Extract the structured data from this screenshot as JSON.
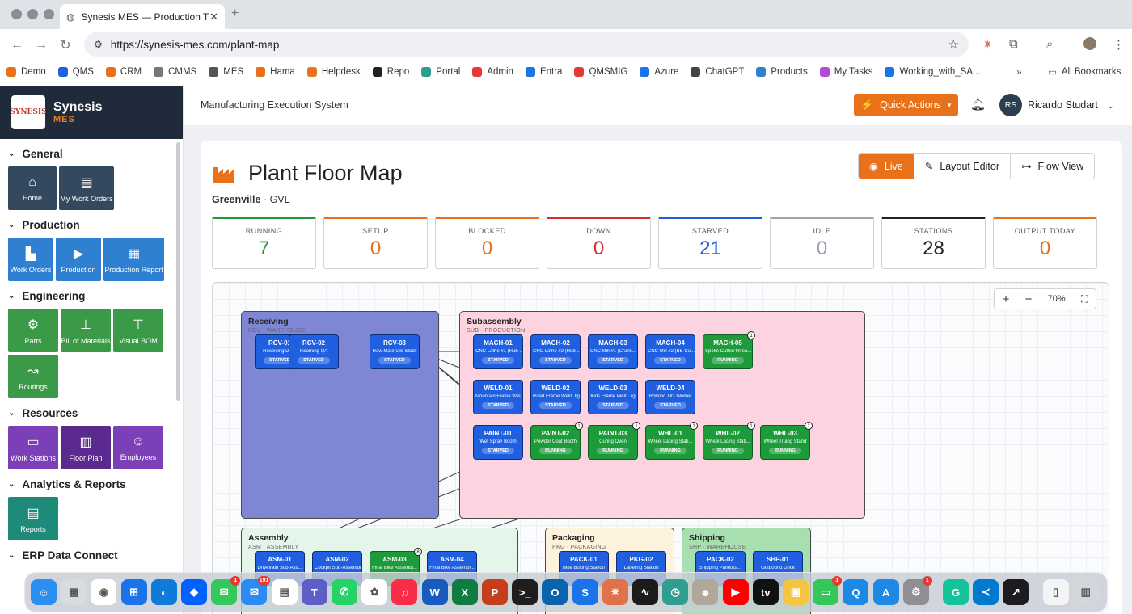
{
  "browser": {
    "tab_title": "Synesis MES — Production Tr",
    "url": "https://synesis-mes.com/plant-map",
    "bookmarks": [
      "Demo",
      "QMS",
      "CRM",
      "CMMS",
      "MES",
      "Hama",
      "Helpdesk",
      "Repo",
      "Portal",
      "Admin",
      "Entra",
      "QMSMIG",
      "Azure",
      "ChatGPT",
      "Products",
      "My Tasks",
      "Working_with_SA..."
    ],
    "all_bookmarks": "All Bookmarks"
  },
  "brand": {
    "name": "Synesis",
    "sub": "MES",
    "logo_text": "SYNESIS"
  },
  "header": {
    "system": "Manufacturing Execution System",
    "quick_actions": "Quick Actions",
    "avatar": "RS",
    "user": "Ricardo Studart"
  },
  "sidebar": {
    "sections": [
      {
        "title": "General",
        "tiles": [
          {
            "label": "Home",
            "icon": "⌂",
            "color": "#34495e"
          },
          {
            "label": "My Work Orders",
            "icon": "▤",
            "color": "#34495e"
          }
        ]
      },
      {
        "title": "Production",
        "tiles": [
          {
            "label": "Work Orders",
            "icon": "▙",
            "color": "#2f80d1"
          },
          {
            "label": "Production",
            "icon": "▶",
            "color": "#2f80d1"
          },
          {
            "label": "Production Report",
            "icon": "▦",
            "color": "#2f80d1"
          }
        ]
      },
      {
        "title": "Engineering",
        "tiles": [
          {
            "label": "Parts",
            "icon": "⚙",
            "color": "#3a9a48"
          },
          {
            "label": "Bill of Materials",
            "icon": "⊥",
            "color": "#3a9a48"
          },
          {
            "label": "Visual BOM",
            "icon": "⊤",
            "color": "#3a9a48"
          },
          {
            "label": "Routings",
            "icon": "↝",
            "color": "#3a9a48"
          }
        ]
      },
      {
        "title": "Resources",
        "tiles": [
          {
            "label": "Work Stations",
            "icon": "▭",
            "color": "#7b3fb8"
          },
          {
            "label": "Floor Plan",
            "icon": "▥",
            "color": "#5b2a8f"
          },
          {
            "label": "Employees",
            "icon": "☺",
            "color": "#7b3fb8"
          }
        ]
      },
      {
        "title": "Analytics & Reports",
        "tiles": [
          {
            "label": "Reports",
            "icon": "▤",
            "color": "#1e8a78"
          }
        ]
      },
      {
        "title": "ERP Data Connect",
        "tiles": []
      }
    ]
  },
  "page": {
    "title": "Plant Floor Map",
    "site": "Greenville",
    "site_code": "GVL",
    "views": [
      "Live",
      "Layout Editor",
      "Flow View"
    ],
    "active_view": "Live",
    "zoom": "70%"
  },
  "stats": [
    {
      "label": "RUNNING",
      "value": "7",
      "color": "#1d9a3a"
    },
    {
      "label": "SETUP",
      "value": "0",
      "color": "#e8711a"
    },
    {
      "label": "BLOCKED",
      "value": "0",
      "color": "#e8711a"
    },
    {
      "label": "DOWN",
      "value": "0",
      "color": "#d32f2f"
    },
    {
      "label": "STARVED",
      "value": "21",
      "color": "#1f5fe0"
    },
    {
      "label": "IDLE",
      "value": "0",
      "color": "#9aa3ad"
    },
    {
      "label": "STATIONS",
      "value": "28",
      "color": "#222222"
    },
    {
      "label": "OUTPUT TODAY",
      "value": "0",
      "color": "#e8711a"
    }
  ],
  "zones": [
    {
      "key": "receiving",
      "title": "Receiving",
      "sub": "RCV · WAREHOUSE",
      "color": "#7f86d6"
    },
    {
      "key": "subassembly",
      "title": "Subassembly",
      "sub": "SUB · PRODUCTION",
      "color": "#fdd3df"
    },
    {
      "key": "assembly",
      "title": "Assembly",
      "sub": "ASM · ASSEMBLY",
      "color": "#e4f5ea"
    },
    {
      "key": "packaging",
      "title": "Packaging",
      "sub": "PKG · PACKAGING",
      "color": "#fdf3dc"
    },
    {
      "key": "shipping",
      "title": "Shipping",
      "sub": "SHP · WAREHOUSE",
      "color": "#a8dfb0"
    }
  ],
  "stations": [
    {
      "id": "RCV-01",
      "name": "Receiving Dock",
      "status": "STARVED",
      "color": "blue",
      "badge": ""
    },
    {
      "id": "RCV-02",
      "name": "Incoming QA",
      "status": "STARVED",
      "color": "blue",
      "badge": ""
    },
    {
      "id": "RCV-03",
      "name": "Raw Materials Stock",
      "status": "STARVED",
      "color": "blue",
      "badge": ""
    },
    {
      "id": "MACH-01",
      "name": "CNC Lathe #1 (Hub ...",
      "status": "STARVED",
      "color": "blue",
      "badge": ""
    },
    {
      "id": "MACH-02",
      "name": "CNC Lathe #2 (Hub ...",
      "status": "STARVED",
      "color": "blue",
      "badge": ""
    },
    {
      "id": "MACH-03",
      "name": "CNC Mill #1 (Crank...",
      "status": "STARVED",
      "color": "blue",
      "badge": ""
    },
    {
      "id": "MACH-04",
      "name": "CNC Mill #2 (BB Cu...",
      "status": "STARVED",
      "color": "blue",
      "badge": ""
    },
    {
      "id": "MACH-05",
      "name": "Spoke Cutter/Threa...",
      "status": "RUNNING",
      "color": "green",
      "badge": "1"
    },
    {
      "id": "WELD-01",
      "name": "Mountain Frame Wel...",
      "status": "STARVED",
      "color": "blue",
      "badge": ""
    },
    {
      "id": "WELD-02",
      "name": "Road Frame Weld Jig",
      "status": "STARVED",
      "color": "blue",
      "badge": ""
    },
    {
      "id": "WELD-03",
      "name": "Kids Frame Weld Jig",
      "status": "STARVED",
      "color": "blue",
      "badge": ""
    },
    {
      "id": "WELD-04",
      "name": "Robotic TIG Welder",
      "status": "STARVED",
      "color": "blue",
      "badge": ""
    },
    {
      "id": "PAINT-01",
      "name": "Wet Spray Booth",
      "status": "STARVED",
      "color": "blue",
      "badge": ""
    },
    {
      "id": "PAINT-02",
      "name": "Powder Coat Booth",
      "status": "RUNNING",
      "color": "green",
      "badge": "1"
    },
    {
      "id": "PAINT-03",
      "name": "Curing Oven",
      "status": "RUNNING",
      "color": "green",
      "badge": "1"
    },
    {
      "id": "WHL-01",
      "name": "Wheel Lacing Stati...",
      "status": "RUNNING",
      "color": "green",
      "badge": "1"
    },
    {
      "id": "WHL-02",
      "name": "Wheel Lacing Stati...",
      "status": "RUNNING",
      "color": "green",
      "badge": "1"
    },
    {
      "id": "WHL-03",
      "name": "Wheel Truing Stand",
      "status": "RUNNING",
      "color": "green",
      "badge": "1"
    },
    {
      "id": "ASM-01",
      "name": "Drivetrain Sub-Ass...",
      "status": "",
      "color": "blue",
      "badge": ""
    },
    {
      "id": "ASM-02",
      "name": "Cockpit Sub-Assembly",
      "status": "",
      "color": "blue",
      "badge": ""
    },
    {
      "id": "ASM-03",
      "name": "Final Bike Assembl...",
      "status": "",
      "color": "green",
      "badge": "8"
    },
    {
      "id": "ASM-04",
      "name": "Final Bike Assembl...",
      "status": "",
      "color": "blue",
      "badge": ""
    },
    {
      "id": "PACK-01",
      "name": "Bike Boxing Station",
      "status": "",
      "color": "blue",
      "badge": ""
    },
    {
      "id": "PKG-02",
      "name": "Labeling Station",
      "status": "",
      "color": "blue",
      "badge": ""
    },
    {
      "id": "PACK-02",
      "name": "Shipping Palletiza...",
      "status": "",
      "color": "blue",
      "badge": ""
    },
    {
      "id": "SHP-01",
      "name": "Outbound Dock",
      "status": "",
      "color": "blue",
      "badge": ""
    }
  ],
  "dock": [
    {
      "name": "finder",
      "color": "#2b8ef0",
      "glyph": "☺",
      "badge": ""
    },
    {
      "name": "launchpad",
      "color": "#d8dbe0",
      "glyph": "▦",
      "badge": ""
    },
    {
      "name": "chrome",
      "color": "#ffffff",
      "glyph": "◉",
      "badge": ""
    },
    {
      "name": "windows-app",
      "color": "#1a73e8",
      "glyph": "⊞",
      "badge": ""
    },
    {
      "name": "edge",
      "color": "#0f7ad8",
      "glyph": "◐",
      "badge": ""
    },
    {
      "name": "dropbox",
      "color": "#0061fe",
      "glyph": "◆",
      "badge": ""
    },
    {
      "name": "messages",
      "color": "#34c759",
      "glyph": "✉",
      "badge": "1"
    },
    {
      "name": "mail",
      "color": "#2a8cf2",
      "glyph": "✉",
      "badge": "191"
    },
    {
      "name": "calendar",
      "color": "#ffffff",
      "glyph": "▤",
      "badge": ""
    },
    {
      "name": "teams",
      "color": "#5b5fc7",
      "glyph": "T",
      "badge": ""
    },
    {
      "name": "whatsapp",
      "color": "#25d366",
      "glyph": "✆",
      "badge": ""
    },
    {
      "name": "photos",
      "color": "#ffffff",
      "glyph": "✿",
      "badge": ""
    },
    {
      "name": "music",
      "color": "#fa2d48",
      "glyph": "♫",
      "badge": ""
    },
    {
      "name": "word",
      "color": "#185abd",
      "glyph": "W",
      "badge": ""
    },
    {
      "name": "excel",
      "color": "#107c41",
      "glyph": "X",
      "badge": ""
    },
    {
      "name": "powerpoint",
      "color": "#c43e1c",
      "glyph": "P",
      "badge": ""
    },
    {
      "name": "terminal",
      "color": "#1e1e1e",
      "glyph": ">_",
      "badge": ""
    },
    {
      "name": "outlook",
      "color": "#0a64ad",
      "glyph": "O",
      "badge": ""
    },
    {
      "name": "synesis",
      "color": "#1a73e8",
      "glyph": "S",
      "badge": ""
    },
    {
      "name": "claude",
      "color": "#e0724a",
      "glyph": "✷",
      "badge": ""
    },
    {
      "name": "activity-monitor",
      "color": "#1b1b1b",
      "glyph": "∿",
      "badge": ""
    },
    {
      "name": "time-machine",
      "color": "#2f9e8f",
      "glyph": "◷",
      "badge": ""
    },
    {
      "name": "contacts",
      "color": "#b0a89a",
      "glyph": "☻",
      "badge": ""
    },
    {
      "name": "youtube",
      "color": "#ff0000",
      "glyph": "▶",
      "badge": ""
    },
    {
      "name": "apple-tv",
      "color": "#111111",
      "glyph": "tv",
      "badge": ""
    },
    {
      "name": "preview",
      "color": "#f5c542",
      "glyph": "▣",
      "badge": ""
    },
    {
      "name": "facetime",
      "color": "#34c759",
      "glyph": "▭",
      "badge": "1"
    },
    {
      "name": "quicktime",
      "color": "#1e88e5",
      "glyph": "Q",
      "badge": ""
    },
    {
      "name": "app-store",
      "color": "#1e88e5",
      "glyph": "A",
      "badge": ""
    },
    {
      "name": "system-settings",
      "color": "#8e8e93",
      "glyph": "⚙",
      "badge": "1"
    },
    {
      "name": "grammarly",
      "color": "#15c39a",
      "glyph": "G",
      "badge": ""
    },
    {
      "name": "vscode",
      "color": "#007acc",
      "glyph": "≺",
      "badge": ""
    },
    {
      "name": "stocks",
      "color": "#1c1c1e",
      "glyph": "↗",
      "badge": ""
    },
    {
      "name": "documents",
      "color": "#f4f4f4",
      "glyph": "▯",
      "badge": ""
    },
    {
      "name": "trash",
      "color": "#d3d6da",
      "glyph": "▥",
      "badge": ""
    }
  ]
}
